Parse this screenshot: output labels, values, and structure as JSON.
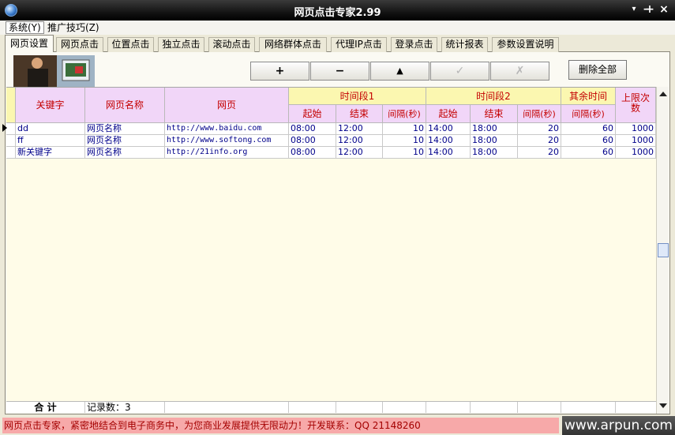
{
  "window": {
    "title": "网页点击专家2.99",
    "controls": [
      "▾",
      "−",
      "+",
      "×"
    ]
  },
  "menubar": {
    "items": [
      "系统(Y)",
      "推广技巧(Z)"
    ]
  },
  "tabs": [
    "网页设置",
    "网页点击",
    "位置点击",
    "独立点击",
    "滚动点击",
    "网络群体点击",
    "代理IP点击",
    "登录点击",
    "统计报表",
    "参数设置说明"
  ],
  "toolbar": {
    "add": "+",
    "remove": "−",
    "up": "▲",
    "confirm": "✓",
    "cancel": "✗",
    "delete_all": "删除全部"
  },
  "grid": {
    "headers": {
      "keyword": "关键字",
      "page_name": "网页名称",
      "url": "网页",
      "period1": "时间段1",
      "period2": "时间段2",
      "other_time": "其余时间",
      "limit": "上限次数",
      "start": "起始",
      "end": "结束",
      "interval": "间隔(秒)"
    },
    "rows": [
      {
        "keyword": "dd",
        "page_name": "网页名称",
        "url": "http://www.baidu.com",
        "p1_start": "08:00",
        "p1_end": "12:00",
        "p1_interval": "10",
        "p2_start": "14:00",
        "p2_end": "18:00",
        "p2_interval": "20",
        "other_interval": "60",
        "limit": "1000"
      },
      {
        "keyword": "ff",
        "page_name": "网页名称",
        "url": "http://www.softong.com",
        "p1_start": "08:00",
        "p1_end": "12:00",
        "p1_interval": "10",
        "p2_start": "14:00",
        "p2_end": "18:00",
        "p2_interval": "20",
        "other_interval": "60",
        "limit": "1000"
      },
      {
        "keyword": "新关键字",
        "page_name": "网页名称",
        "url": "http://21info.org",
        "p1_start": "08:00",
        "p1_end": "12:00",
        "p1_interval": "10",
        "p2_start": "14:00",
        "p2_end": "18:00",
        "p2_interval": "20",
        "other_interval": "60",
        "limit": "1000"
      }
    ],
    "footer": {
      "total_label": "合  计",
      "record_count": "记录数：3"
    }
  },
  "statusbar": {
    "text": "网页点击专家，紧密地结合到电子商务中，为您商业发展提供无限动力！开发联系：QQ 21148260",
    "watermark": "www.arpun.com"
  },
  "colors": {
    "header_pink": "#f1d6f8",
    "header_yellow": "#fbf7b0",
    "header_text": "#c40000",
    "cell_text": "#00008a",
    "status_bg": "#f7a9a9"
  }
}
